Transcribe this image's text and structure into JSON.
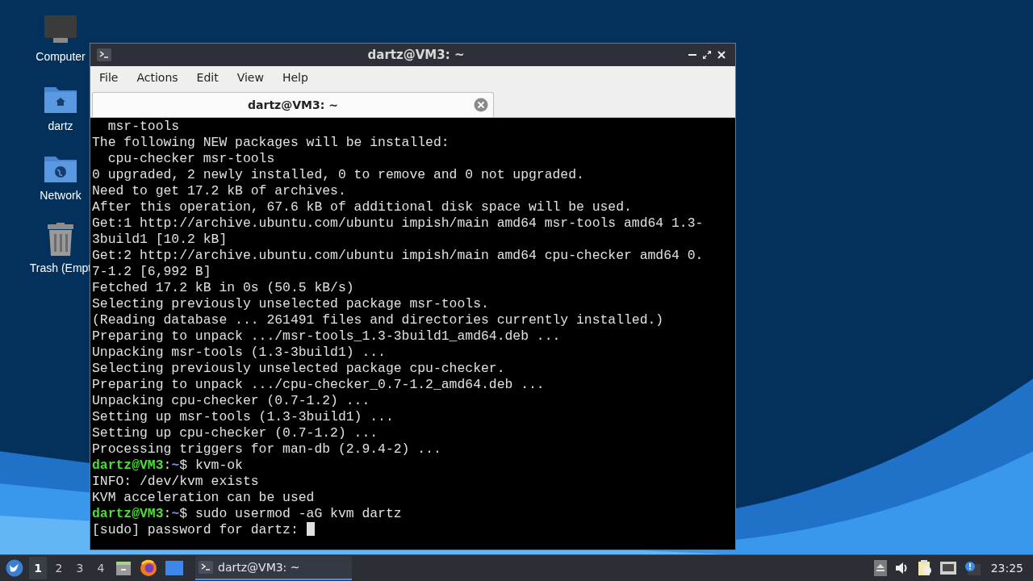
{
  "desktop_icons": [
    {
      "kind": "computer",
      "label": "Computer"
    },
    {
      "kind": "home",
      "label": "dartz"
    },
    {
      "kind": "network",
      "label": "Network"
    },
    {
      "kind": "trash",
      "label": "Trash (Empt"
    }
  ],
  "window": {
    "title": "dartz@VM3: ~",
    "menu": [
      "File",
      "Actions",
      "Edit",
      "View",
      "Help"
    ],
    "tabs": [
      {
        "label": "dartz@VM3: ~",
        "selected": true
      }
    ],
    "terminal": [
      {
        "kind": "text",
        "text": "  msr-tools"
      },
      {
        "kind": "text",
        "text": "The following NEW packages will be installed:"
      },
      {
        "kind": "text",
        "text": "  cpu-checker msr-tools"
      },
      {
        "kind": "text",
        "text": "0 upgraded, 2 newly installed, 0 to remove and 0 not upgraded."
      },
      {
        "kind": "text",
        "text": "Need to get 17.2 kB of archives."
      },
      {
        "kind": "text",
        "text": "After this operation, 67.6 kB of additional disk space will be used."
      },
      {
        "kind": "text",
        "text": "Get:1 http://archive.ubuntu.com/ubuntu impish/main amd64 msr-tools amd64 1.3-"
      },
      {
        "kind": "text",
        "text": "3build1 [10.2 kB]"
      },
      {
        "kind": "text",
        "text": "Get:2 http://archive.ubuntu.com/ubuntu impish/main amd64 cpu-checker amd64 0."
      },
      {
        "kind": "text",
        "text": "7-1.2 [6,992 B]"
      },
      {
        "kind": "text",
        "text": "Fetched 17.2 kB in 0s (50.5 kB/s)"
      },
      {
        "kind": "text",
        "text": "Selecting previously unselected package msr-tools."
      },
      {
        "kind": "text",
        "text": "(Reading database ... 261491 files and directories currently installed.)"
      },
      {
        "kind": "text",
        "text": "Preparing to unpack .../msr-tools_1.3-3build1_amd64.deb ..."
      },
      {
        "kind": "text",
        "text": "Unpacking msr-tools (1.3-3build1) ..."
      },
      {
        "kind": "text",
        "text": "Selecting previously unselected package cpu-checker."
      },
      {
        "kind": "text",
        "text": "Preparing to unpack .../cpu-checker_0.7-1.2_amd64.deb ..."
      },
      {
        "kind": "text",
        "text": "Unpacking cpu-checker (0.7-1.2) ..."
      },
      {
        "kind": "text",
        "text": "Setting up msr-tools (1.3-3build1) ..."
      },
      {
        "kind": "text",
        "text": "Setting up cpu-checker (0.7-1.2) ..."
      },
      {
        "kind": "text",
        "text": "Processing triggers for man-db (2.9.4-2) ..."
      },
      {
        "kind": "prompt",
        "user": "dartz@VM3",
        "sep": ":",
        "path": "~",
        "command": "$ kvm-ok"
      },
      {
        "kind": "text",
        "text": "INFO: /dev/kvm exists"
      },
      {
        "kind": "text",
        "text": "KVM acceleration can be used"
      },
      {
        "kind": "prompt",
        "user": "dartz@VM3",
        "sep": ":",
        "path": "~",
        "command": "$ sudo usermod -aG kvm dartz"
      },
      {
        "kind": "input",
        "text": "[sudo] password for dartz: "
      }
    ]
  },
  "taskbar": {
    "workspaces": [
      {
        "label": "1",
        "selected": true
      },
      {
        "label": "2",
        "selected": false
      },
      {
        "label": "3",
        "selected": false
      },
      {
        "label": "4",
        "selected": false
      }
    ],
    "launchers": [
      {
        "kind": "files"
      },
      {
        "kind": "browser"
      },
      {
        "kind": "desktop"
      }
    ],
    "tasks": [
      {
        "label": "dartz@VM3: ~",
        "selected": true
      }
    ],
    "tray": [
      {
        "kind": "eject"
      },
      {
        "kind": "volume"
      },
      {
        "kind": "clipboard"
      },
      {
        "kind": "network"
      },
      {
        "kind": "notification"
      }
    ],
    "clock": "23:25"
  }
}
